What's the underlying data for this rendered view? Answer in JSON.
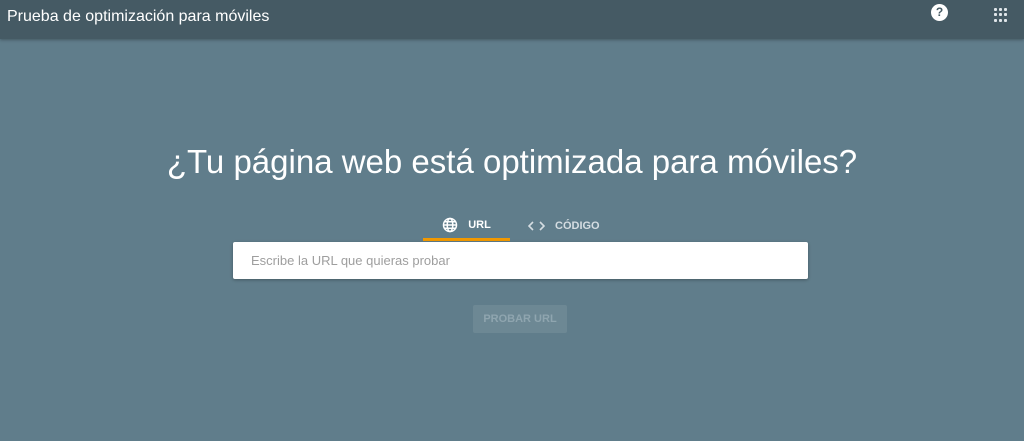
{
  "header": {
    "title": "Prueba de optimización para móviles",
    "help_icon": "?"
  },
  "main": {
    "heading": "¿Tu página web está optimizada para móviles?",
    "tabs": [
      {
        "label": "URL",
        "icon": "globe-icon"
      },
      {
        "label": "CÓDIGO",
        "icon": "code-icon"
      }
    ],
    "url_input": {
      "placeholder": "Escribe la URL que quieras probar",
      "value": ""
    },
    "submit_label": "PROBAR URL"
  },
  "colors": {
    "header": "#455a64",
    "background": "#607d8b",
    "accent": "#f29900"
  }
}
